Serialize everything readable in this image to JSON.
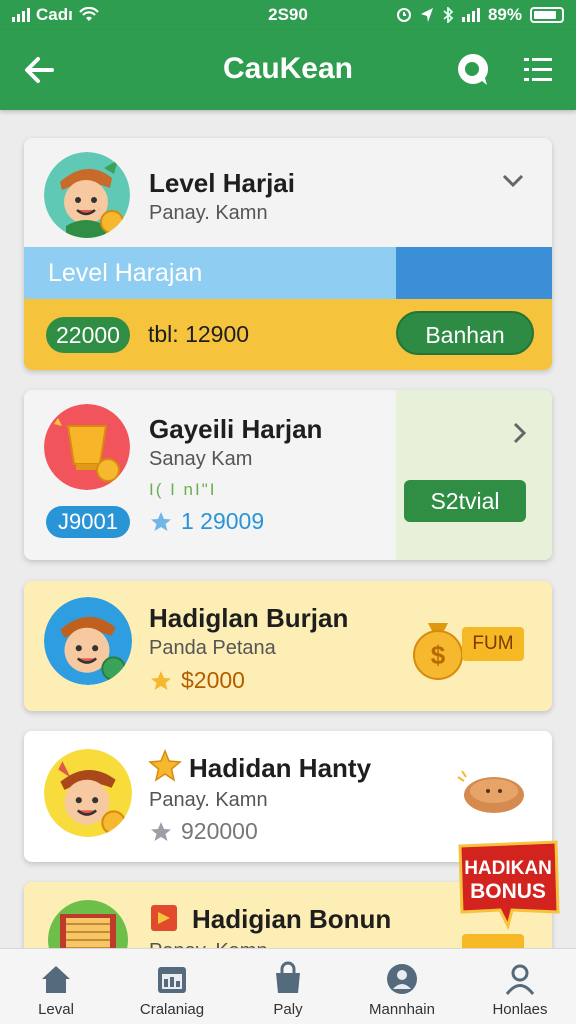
{
  "status_bar": {
    "carrier": "Cadı",
    "time": "2S90",
    "battery": "89%"
  },
  "app_bar": {
    "title": "CauKean"
  },
  "cards": [
    {
      "title": "Level Harjai",
      "subtitle": "Panay. Kamn",
      "strip_label": "Level Harajan",
      "points": "22000",
      "total": "tbl: 12900",
      "action": "Banhan"
    },
    {
      "title": "Gayeili Harjan",
      "subtitle": "Sanay Kam",
      "progress_text": "I( I nI\"I",
      "points": "J9001",
      "rating": "1 29009",
      "action": "S2tvial"
    },
    {
      "title": "Hadiglan Burjan",
      "subtitle": "Panda Petana",
      "rating": "$2000",
      "tag": "FUM"
    },
    {
      "title": "Hadidan Hanty",
      "subtitle": "Panay. Kamn",
      "rating": "920000"
    },
    {
      "title": "Hadigian Bonun",
      "subtitle": "Panay. Kamn"
    }
  ],
  "bonus_badge": {
    "line1": "HADIKAN",
    "line2": "BONUS"
  },
  "bottom_nav": [
    {
      "label": "Leval"
    },
    {
      "label": "Cralaniag"
    },
    {
      "label": "Paly"
    },
    {
      "label": "Mannhain"
    },
    {
      "label": "Honlaes"
    }
  ],
  "colors": {
    "primary_green": "#2e9d4f",
    "accent_blue": "#3b8fd6",
    "accent_yellow": "#f6c33c",
    "star": "#f5b82e"
  }
}
